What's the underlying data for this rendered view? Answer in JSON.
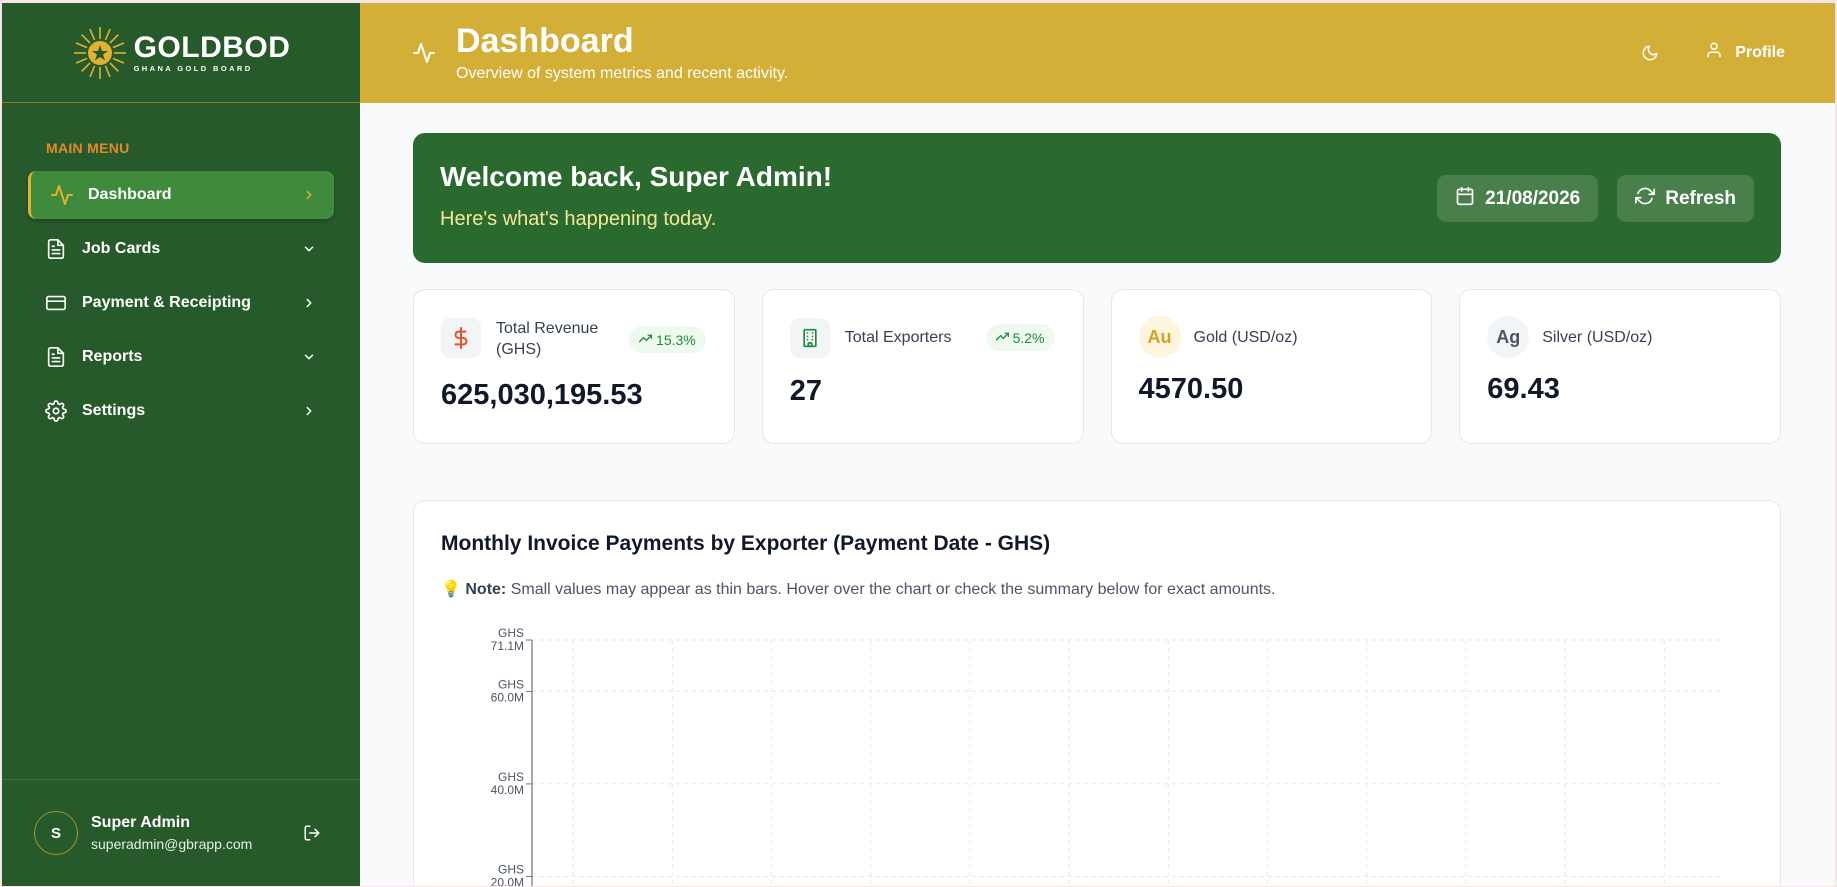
{
  "brand": {
    "name": "GOLDBOD",
    "tagline": "GHANA GOLD BOARD"
  },
  "sidebar": {
    "menu_label": "MAIN MENU",
    "items": [
      {
        "label": "Dashboard",
        "icon": "activity-icon",
        "chevron": "right",
        "active": true
      },
      {
        "label": "Job Cards",
        "icon": "document-icon",
        "chevron": "down",
        "active": false
      },
      {
        "label": "Payment & Receipting",
        "icon": "credit-card-icon",
        "chevron": "right",
        "active": false
      },
      {
        "label": "Reports",
        "icon": "document-icon",
        "chevron": "down",
        "active": false
      },
      {
        "label": "Settings",
        "icon": "gear-icon",
        "chevron": "right",
        "active": false
      }
    ],
    "user": {
      "initial": "S",
      "name": "Super Admin",
      "email": "superadmin@gbrapp.com"
    }
  },
  "header": {
    "title": "Dashboard",
    "subtitle": "Overview of system metrics and recent activity.",
    "profile_label": "Profile"
  },
  "welcome": {
    "title": "Welcome back, Super Admin!",
    "subtitle": "Here's what's happening today.",
    "date": "21/08/2026",
    "refresh_label": "Refresh"
  },
  "stats": [
    {
      "label": "Total Revenue (GHS)",
      "value": "625,030,195.53",
      "badge": "15.3%",
      "icon": "dollar-icon"
    },
    {
      "label": "Total Exporters",
      "value": "27",
      "badge": "5.2%",
      "icon": "building-icon"
    },
    {
      "label": "Gold (USD/oz)",
      "value": "4570.50",
      "icon_text": "Au"
    },
    {
      "label": "Silver (USD/oz)",
      "value": "69.43",
      "icon_text": "Ag"
    }
  ],
  "chart": {
    "title": "Monthly Invoice Payments by Exporter (Payment Date - GHS)",
    "note_label": "Note:",
    "note_text": " Small values may appear as thin bars. Hover over the chart or check the summary below for exact amounts."
  },
  "chart_data": {
    "type": "bar",
    "title": "Monthly Invoice Payments by Exporter (Payment Date - GHS)",
    "ylim": [
      0,
      71.1
    ],
    "yticks": [
      {
        "value": 71.1,
        "prefix": "GHS",
        "label": "71.1M"
      },
      {
        "value": 60.0,
        "prefix": "GHS",
        "label": "60.0M"
      },
      {
        "value": 40.0,
        "prefix": "GHS",
        "label": "40.0M"
      },
      {
        "value": 20.0,
        "prefix": "GHS",
        "label": "20.0M"
      }
    ],
    "grid": true,
    "categories": [],
    "series": []
  },
  "colors": {
    "sidebar": "#275a2a",
    "header": "#d4af37",
    "accent_orange": "#e28a2a",
    "welcome": "#2b6a2e"
  }
}
